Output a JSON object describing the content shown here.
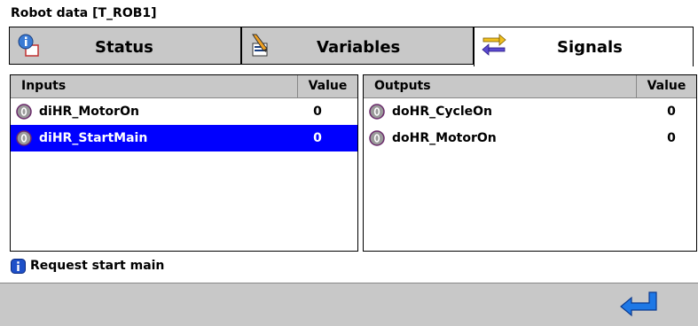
{
  "window": {
    "title": "Robot data [T_ROB1]"
  },
  "tabs": [
    {
      "label": "Status",
      "icon": "status-info-icon",
      "active": false
    },
    {
      "label": "Variables",
      "icon": "variables-pencil-icon",
      "active": false
    },
    {
      "label": "Signals",
      "icon": "signals-arrows-icon",
      "active": true
    }
  ],
  "inputs": {
    "header_name": "Inputs",
    "header_value": "Value",
    "rows": [
      {
        "name": "diHR_MotorOn",
        "value": "0",
        "selected": false
      },
      {
        "name": "diHR_StartMain",
        "value": "0",
        "selected": true
      }
    ]
  },
  "outputs": {
    "header_name": "Outputs",
    "header_value": "Value",
    "rows": [
      {
        "name": "doHR_CycleOn",
        "value": "0",
        "selected": false
      },
      {
        "name": "doHR_MotorOn",
        "value": "0",
        "selected": false
      }
    ]
  },
  "status": {
    "text": "Request start main",
    "icon": "info-icon"
  },
  "footer": {
    "enter_icon": "enter-return-icon"
  },
  "colors": {
    "selection": "#0000ff",
    "tab_inactive": "#c8c8c8",
    "enter_arrow": "#1e78e6"
  }
}
